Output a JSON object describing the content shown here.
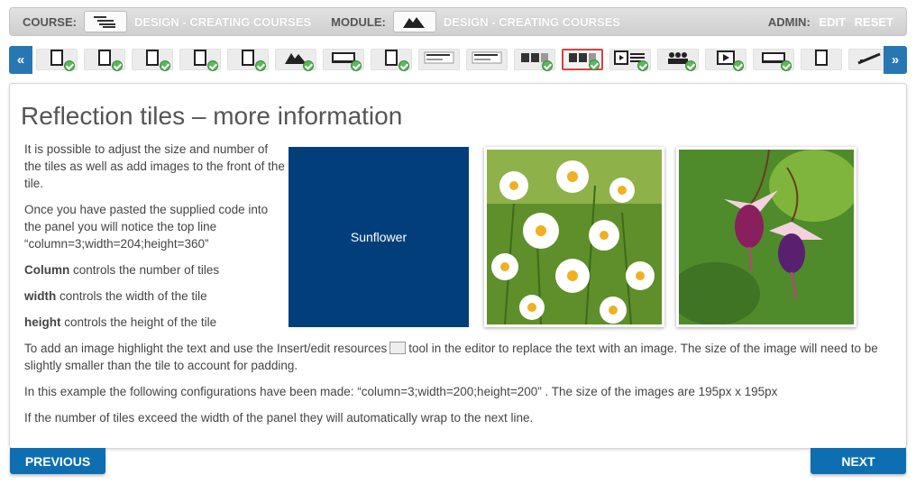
{
  "topbar": {
    "course_label": "COURSE:",
    "course_value": "DESIGN - CREATING COURSES",
    "module_label": "MODULE:",
    "module_value": "DESIGN - CREATING COURSES",
    "admin_label": "ADMIN:",
    "edit_label": "EDIT",
    "reset_label": "RESET"
  },
  "nav": {
    "prev_arrow": "«",
    "next_arrow": "»",
    "thumbnails": [
      {
        "icon": "page-icon",
        "done": true
      },
      {
        "icon": "page-icon",
        "done": true
      },
      {
        "icon": "page-icon",
        "done": true
      },
      {
        "icon": "page-icon",
        "done": true
      },
      {
        "icon": "page-icon",
        "done": true
      },
      {
        "icon": "image-icon",
        "done": true
      },
      {
        "icon": "video-icon",
        "done": true
      },
      {
        "icon": "page-icon",
        "done": true
      },
      {
        "icon": "text-layout-icon",
        "done": false
      },
      {
        "icon": "text-layout-icon",
        "done": false
      },
      {
        "icon": "tiles-icon",
        "done": true
      },
      {
        "icon": "tiles-icon",
        "done": true,
        "active": true
      },
      {
        "icon": "film-list-icon",
        "done": true
      },
      {
        "icon": "people-icon",
        "done": true
      },
      {
        "icon": "film-icon",
        "done": true
      },
      {
        "icon": "video-icon",
        "done": true
      },
      {
        "icon": "page-icon",
        "done": false
      },
      {
        "icon": "sign-icon",
        "done": false
      }
    ]
  },
  "content": {
    "title": "Reflection tiles – more information",
    "para1": "It is possible to adjust the size and number of the tiles as well as add images to the front of the tile.",
    "para2": "Once you have pasted the supplied code into the panel you will notice the top line “column=3;width=204;height=360”",
    "column_bold": "Column",
    "column_rest": " controls the number of tiles",
    "width_bold": "width",
    "width_rest": " controls the width of the tile",
    "height_bold": "height",
    "height_rest": " controls the height of the tile",
    "tile_label": "Sunflower",
    "para_insert_a": "To add an image highlight the text and use the Insert/edit resources",
    "para_insert_b": "tool in the editor to replace the text with an image. The size of the image will need to be slightly smaller than the tile to account for padding.",
    "para_example": "In this example the following configurations have been made: “column=3;width=200;height=200” . The size of the images are 195px x 195px",
    "para_wrap": "If the number of tiles exceed the width of the panel they will automatically wrap to the next line."
  },
  "buttons": {
    "previous": "PREVIOUS",
    "next": "NEXT"
  },
  "colors": {
    "accent": "#0d6fb2",
    "tile_blue": "#023f7a",
    "check_green": "#5cb85c",
    "active_border": "#d9403f"
  }
}
